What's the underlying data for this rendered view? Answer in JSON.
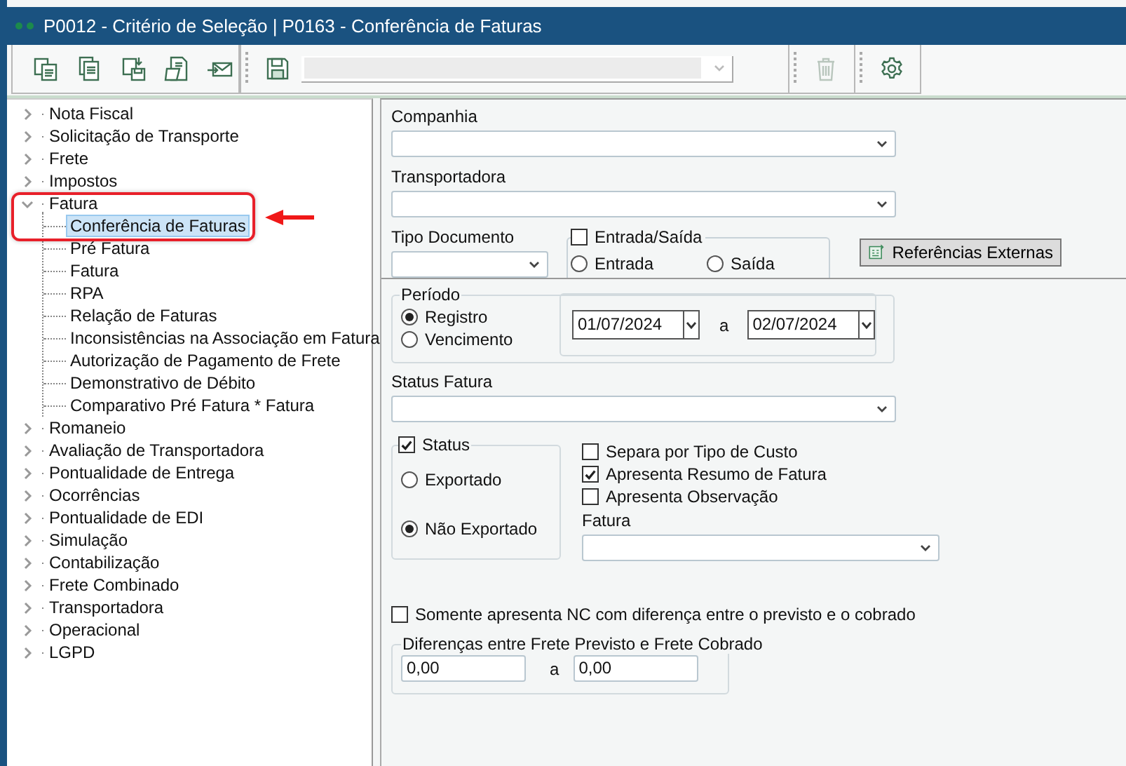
{
  "window": {
    "title": "P0012 - Critério de Seleção | P0163 - Conferência de Faturas"
  },
  "toolbar": {
    "groups": [
      {
        "buttons": [
          {
            "disabled": false
          },
          {
            "disabled": false
          },
          {
            "disabled": false
          },
          {
            "disabled": false
          },
          {
            "disabled": false
          }
        ]
      },
      {
        "buttons": [
          {
            "disabled": false
          }
        ],
        "combo": {
          "disabled": true
        }
      },
      {
        "buttons": [
          {
            "disabled": true
          }
        ]
      },
      {
        "buttons": [
          {
            "disabled": false
          }
        ]
      }
    ]
  },
  "tree": {
    "items": [
      {
        "label": "Nota Fiscal",
        "expanded": false
      },
      {
        "label": "Solicitação de Transporte",
        "expanded": false
      },
      {
        "label": "Frete",
        "expanded": false
      },
      {
        "label": "Impostos",
        "expanded": false
      },
      {
        "label": "Fatura",
        "expanded": true,
        "children": [
          {
            "label": "Conferência de Faturas",
            "selected": true
          },
          {
            "label": "Pré Fatura",
            "selected": false
          },
          {
            "label": "Fatura",
            "selected": false
          },
          {
            "label": "RPA",
            "selected": false
          },
          {
            "label": "Relação de Faturas",
            "selected": false
          },
          {
            "label": "Inconsistências na Associação em Fatura",
            "selected": false
          },
          {
            "label": "Autorização de Pagamento de Frete",
            "selected": false
          },
          {
            "label": "Demonstrativo de Débito",
            "selected": false
          },
          {
            "label": "Comparativo Pré Fatura * Fatura",
            "selected": false
          }
        ]
      },
      {
        "label": "Romaneio",
        "expanded": false
      },
      {
        "label": "Avaliação de Transportadora",
        "expanded": false
      },
      {
        "label": "Pontualidade de Entrega",
        "expanded": false
      },
      {
        "label": "Ocorrências",
        "expanded": false
      },
      {
        "label": "Pontualidade de EDI",
        "expanded": false
      },
      {
        "label": "Simulação",
        "expanded": false
      },
      {
        "label": "Contabilização",
        "expanded": false
      },
      {
        "label": "Frete Combinado",
        "expanded": false
      },
      {
        "label": "Transportadora",
        "expanded": false
      },
      {
        "label": "Operacional",
        "expanded": false
      },
      {
        "label": "LGPD",
        "expanded": false
      }
    ]
  },
  "form": {
    "companhia": {
      "label": "Companhia"
    },
    "transportadora": {
      "label": "Transportadora"
    },
    "tipo_documento": {
      "label": "Tipo Documento"
    },
    "entrada_saida": {
      "label": "Entrada/Saída",
      "checked": false,
      "options": [
        {
          "label": "Entrada",
          "selected": false
        },
        {
          "label": "Saída",
          "selected": false
        }
      ]
    },
    "referencias_button": {
      "label": "Referências Externas"
    },
    "periodo": {
      "label": "Período",
      "options": [
        {
          "label": "Registro",
          "selected": true
        },
        {
          "label": "Vencimento",
          "selected": false
        }
      ],
      "date_from": "01/07/2024",
      "separator": "a",
      "date_to": "02/07/2024"
    },
    "status_fatura": {
      "label": "Status Fatura"
    },
    "status": {
      "label": "Status",
      "checked": true,
      "options": [
        {
          "label": "Exportado",
          "selected": false
        },
        {
          "label": "Não Exportado",
          "selected": true
        }
      ]
    },
    "checkboxes": [
      {
        "label": "Separa por Tipo de Custo",
        "checked": false
      },
      {
        "label": "Apresenta Resumo de Fatura",
        "checked": true
      },
      {
        "label": "Apresenta Observação",
        "checked": false
      }
    ],
    "fatura": {
      "label": "Fatura"
    },
    "somente_nc": {
      "label": "Somente apresenta NC com diferença entre o previsto e o cobrado",
      "checked": false
    },
    "diferencas": {
      "label": "Diferenças entre Frete Previsto e Frete Cobrado",
      "from": "0,00",
      "separator": "a",
      "to": "0,00"
    }
  }
}
